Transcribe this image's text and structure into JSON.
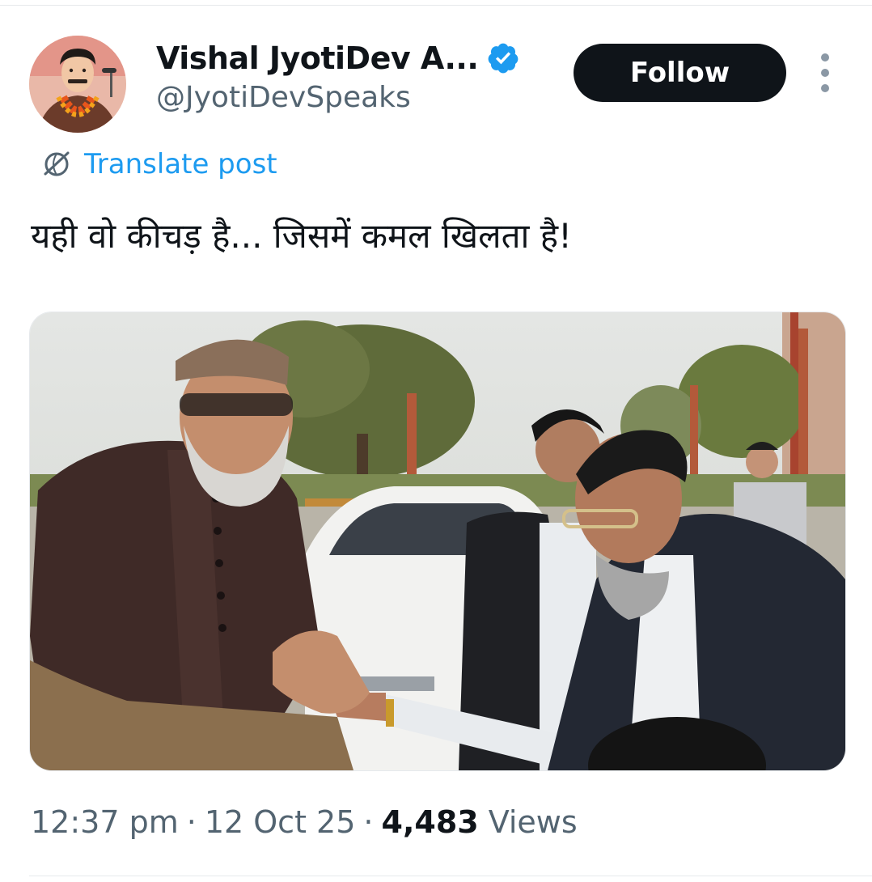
{
  "author": {
    "display_name": "Vishal JyotiDev A...",
    "handle": "@JyotiDevSpeaks",
    "avatar_icon": "profile-avatar",
    "verified_icon": "verified-badge-icon",
    "verified_color": "#1d9bf0"
  },
  "actions": {
    "follow_label": "Follow",
    "more_icon": "more-options-icon"
  },
  "translate": {
    "icon": "translate-globe-icon",
    "label": "Translate post",
    "color": "#1d9bf0"
  },
  "post": {
    "text": "यही वो कीचड़ है... जिसमें कमल खिलता है!",
    "media": "photo"
  },
  "meta": {
    "time": "12:37 pm",
    "separator": "·",
    "date": "12 Oct 25",
    "views_count": "4,483",
    "views_label": "Views"
  }
}
